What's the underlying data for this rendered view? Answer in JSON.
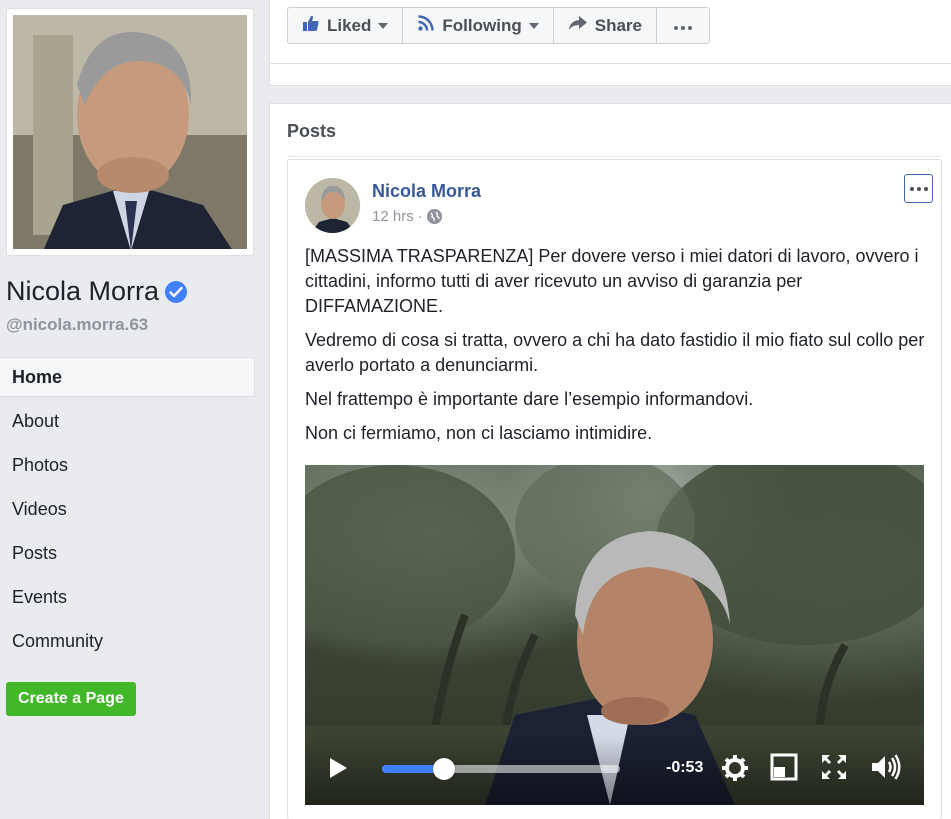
{
  "profile": {
    "name": "Nicola Morra",
    "handle": "@nicola.morra.63"
  },
  "nav": {
    "items": [
      {
        "label": "Home",
        "active": true
      },
      {
        "label": "About"
      },
      {
        "label": "Photos"
      },
      {
        "label": "Videos"
      },
      {
        "label": "Posts"
      },
      {
        "label": "Events"
      },
      {
        "label": "Community"
      }
    ],
    "create_page": "Create a Page"
  },
  "actions": {
    "liked": "Liked",
    "following": "Following",
    "share": "Share"
  },
  "posts": {
    "title": "Posts",
    "post": {
      "author": "Nicola Morra",
      "time": "12 hrs",
      "separator": "·",
      "paragraphs": [
        "[MASSIMA TRASPARENZA] Per dovere verso i miei datori di lavoro, ovvero i cittadini, informo tutti di aver ricevuto un avviso di garanzia per DIFFAMAZIONE.",
        "Vedremo di cosa si tratta, ovvero a chi ha dato fastidio il mio fiato sul collo per averlo portato a denunciarmi.",
        "Nel frattempo è importante dare l’esempio informandovi.",
        "Non ci fermiamo, non ci lasciamo intimidire."
      ],
      "video": {
        "remaining": "-0:53",
        "progress": 0.26
      }
    }
  },
  "colors": {
    "link": "#365899",
    "create_button": "#42b72a",
    "verified": "#4080ff",
    "progress": "#4080ff"
  }
}
